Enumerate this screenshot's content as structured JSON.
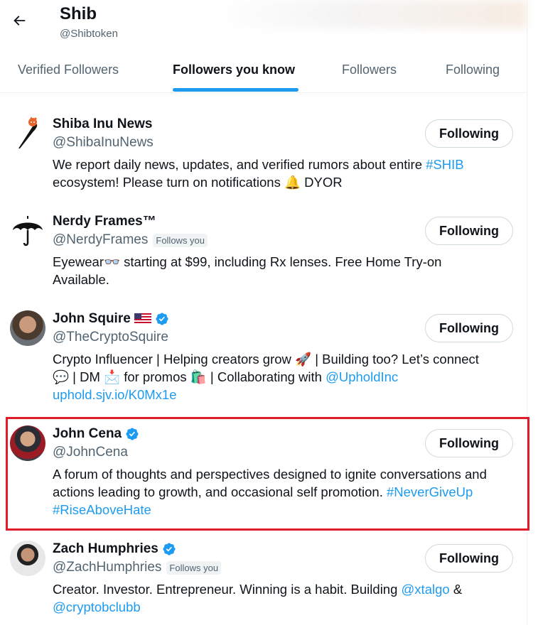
{
  "header": {
    "title": "Shib",
    "handle": "@Shibtoken",
    "back_icon": "arrow-left-icon"
  },
  "tabs": [
    {
      "label": "Verified Followers",
      "active": false
    },
    {
      "label": "Followers you know",
      "active": true
    },
    {
      "label": "Followers",
      "active": false
    },
    {
      "label": "Following",
      "active": false
    }
  ],
  "accent_color": "#1d9bf0",
  "highlight_color": "#e21b2a",
  "users": [
    {
      "name": "Shiba Inu News",
      "handle": "@ShibaInuNews",
      "follows_you": "",
      "button": "Following",
      "bio": {
        "t1": "We report daily news, updates, and verified rumors about entire ",
        "link1": "#SHIB",
        "t2": "ecosystem! Please turn on notifications 🔔 DYOR"
      }
    },
    {
      "name": "Nerdy Frames™",
      "handle": "@NerdyFrames",
      "follows_you": "Follows you",
      "button": "Following",
      "bio": {
        "t1": "Eyewear👓 starting at $99, including Rx lenses. Free Home Try-on",
        "t2": "Available."
      }
    },
    {
      "name": "John Squire",
      "handle": "@TheCryptoSquire",
      "follows_you": "",
      "button": "Following",
      "bio": {
        "t1": "Crypto Influencer | Helping creators grow 🚀 | Building too? Let’s connect",
        "t2": "💬 | DM 📩 for promos 🛍️ | Collaborating with ",
        "link1": "@UpholdInc",
        "link2": "uphold.sjv.io/K0Mx1e"
      }
    },
    {
      "name": "John Cena",
      "handle": "@JohnCena",
      "follows_you": "",
      "button": "Following",
      "bio": {
        "t1": "A forum of thoughts and perspectives designed to ignite conversations and",
        "t2": "actions leading to growth, and occasional self promotion. ",
        "link1": "#NeverGiveUp",
        "link2": "#RiseAboveHate"
      }
    },
    {
      "name": "Zach Humphries",
      "handle": "@ZachHumphries",
      "follows_you": "Follows you",
      "button": "Following",
      "bio": {
        "t1": "Creator. Investor. Entrepreneur. Winning is a habit. Building ",
        "link1": "@xtalgo",
        "t2": " &",
        "link2": "@cryptobclubb"
      }
    }
  ]
}
